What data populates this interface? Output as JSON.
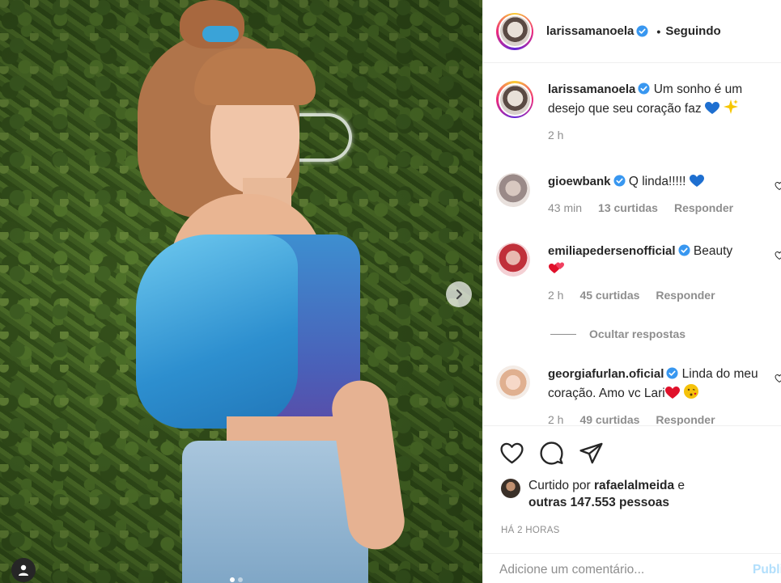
{
  "post": {
    "image_alt": "",
    "carousel_dots": 2,
    "carousel_active": 0
  },
  "header": {
    "username": "larissamanoela",
    "follow_separator": "•",
    "follow_status": "Seguindo"
  },
  "caption": {
    "username": "larissamanoela",
    "text": "Um sonho é um desejo que seu coração faz",
    "emojis": [
      "blue-heart",
      "sparkles"
    ],
    "time": "2 h"
  },
  "comments": [
    {
      "username": "gioewbank",
      "text": "Q linda!!!!!",
      "emoji": "blue-heart",
      "time": "43 min",
      "likes": "13 curtidas",
      "reply": "Responder"
    },
    {
      "username": "emiliapedersenofficial",
      "text": "Beauty",
      "emoji": "two-hearts",
      "time": "2 h",
      "likes": "45 curtidas",
      "reply": "Responder"
    },
    {
      "username": "georgiafurlan.oficial",
      "text": "Linda do meu coração. Amo vc Lari",
      "emoji": "red-heart-kiss",
      "time": "2 h",
      "likes": "49 curtidas",
      "reply": "Responder"
    }
  ],
  "hide_replies": "Ocultar respostas",
  "likes": {
    "prefix": "Curtido por",
    "user": "rafaelalmeida",
    "connector": "e",
    "others": "outras 147.553 pessoas"
  },
  "timestamp": "HÁ 2 HORAS",
  "add_comment": {
    "placeholder": "Adicione um comentário...",
    "publish": "Publicar"
  },
  "colors": {
    "verified": "#3897f0",
    "muted": "#8e8e8e",
    "publish_disabled": "#b2dffc",
    "border": "#efefef"
  },
  "icons": [
    "heart-icon",
    "comment-icon",
    "share-icon",
    "verified-icon",
    "chevron-right-icon",
    "user-tag-icon"
  ]
}
